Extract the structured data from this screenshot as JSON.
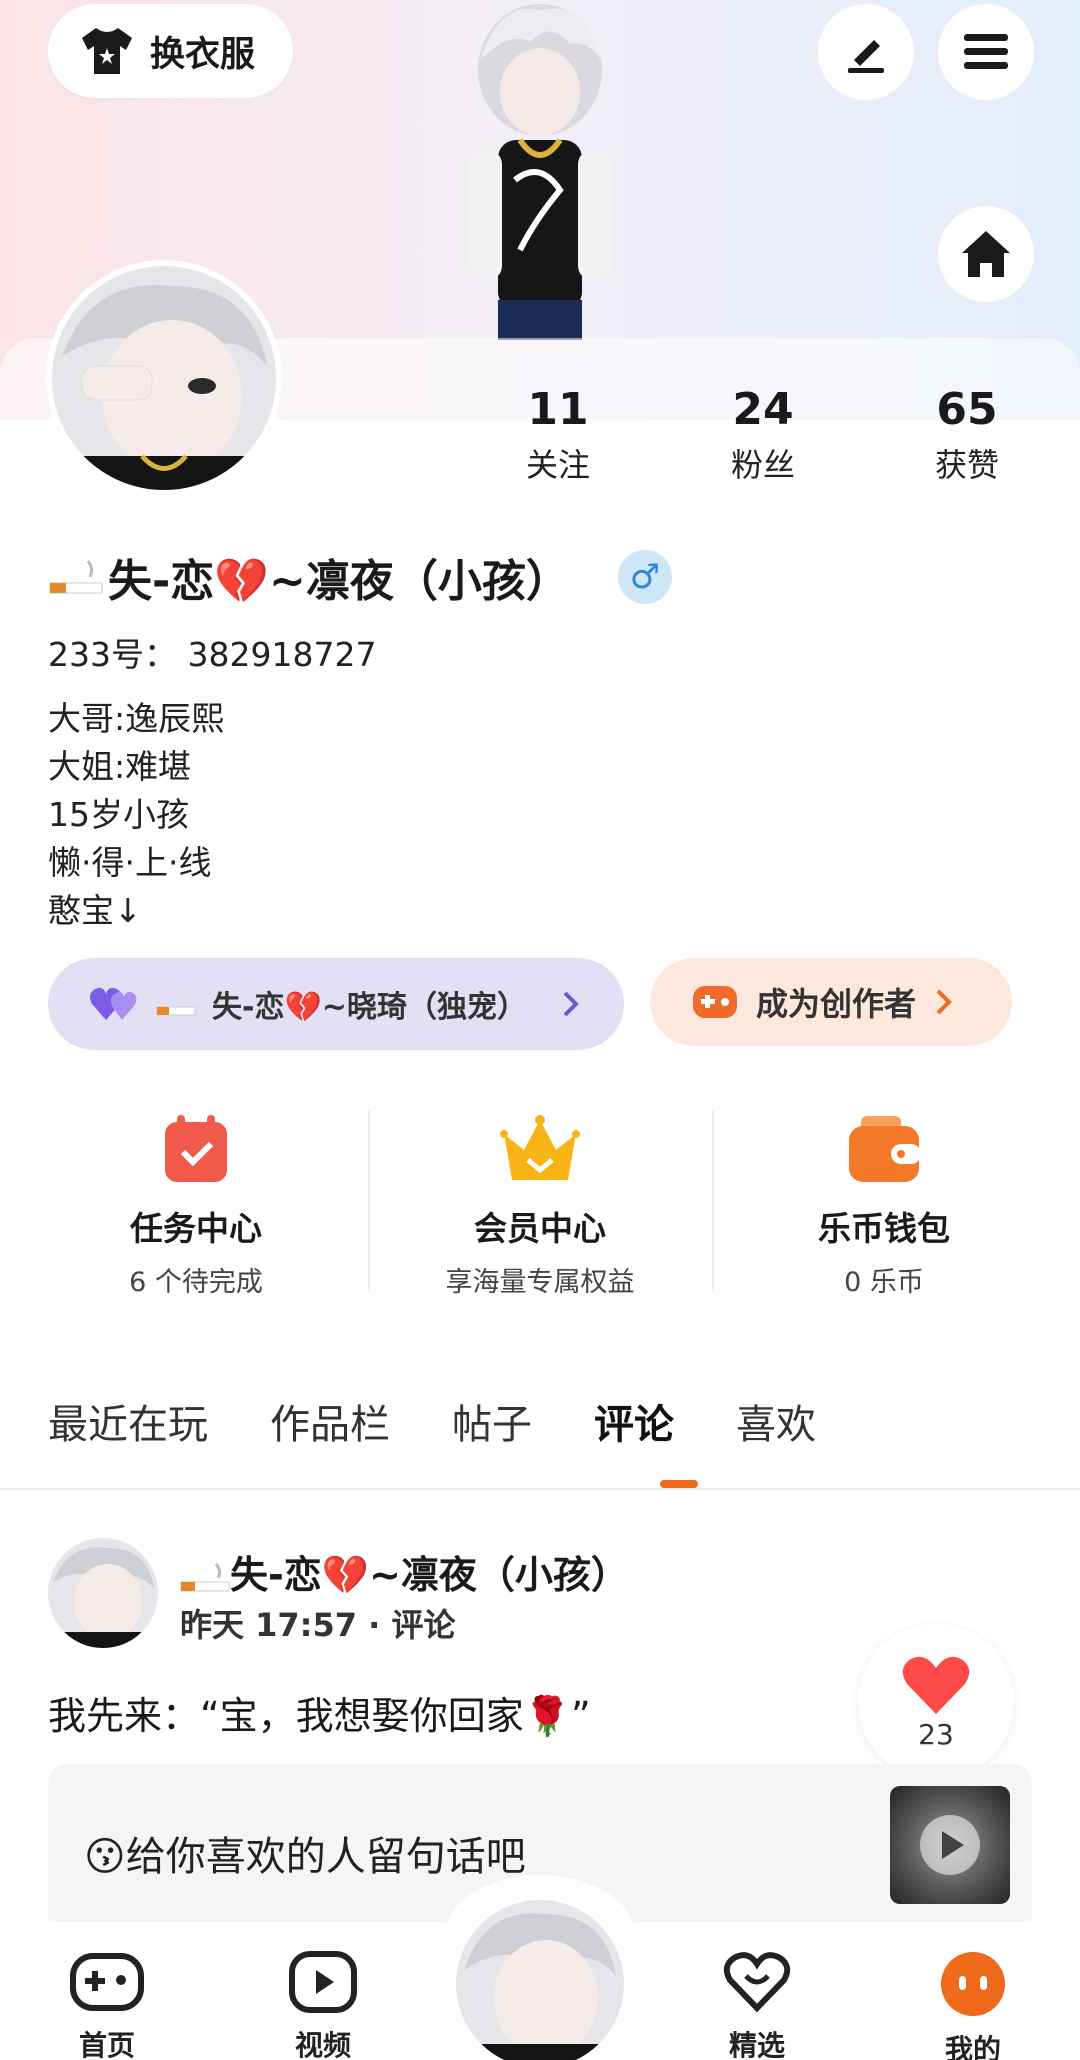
{
  "header": {
    "dress_button_label": "换衣服"
  },
  "stats": [
    {
      "count": "11",
      "label": "关注"
    },
    {
      "count": "24",
      "label": "粉丝"
    },
    {
      "count": "65",
      "label": "获赞"
    }
  ],
  "profile": {
    "name": "失-恋💔~凛夜（小孩）",
    "gender_symbol": "♂",
    "uid": "233号：  382918727",
    "bio_lines": [
      "大哥:逸辰熙",
      "大姐:难堪",
      "15岁小孩",
      "懒·得·上·线",
      "憨宝↓"
    ]
  },
  "love_link": {
    "label": "失-恋💔~晓琦（独宠）"
  },
  "creator": {
    "label": "成为创作者"
  },
  "services": [
    {
      "title": "任务中心",
      "sub": "6 个待完成",
      "icon": "calendar-check-icon",
      "color": "#f15a4a"
    },
    {
      "title": "会员中心",
      "sub": "享海量专属权益",
      "icon": "crown-icon",
      "color": "#f9b516"
    },
    {
      "title": "乐币钱包",
      "sub": "0 乐币",
      "icon": "wallet-icon",
      "color": "#f47a2a"
    }
  ],
  "tabs": [
    "最近在玩",
    "作品栏",
    "帖子",
    "评论",
    "喜欢"
  ],
  "active_tab": "评论",
  "post": {
    "author": "失-恋💔~凛夜（小孩）",
    "meta": "昨天 17:57 · 评论",
    "text": "我先来：“宝，我想娶你回家🌹”",
    "like_count": "23",
    "quote": "😗给你喜欢的人留句话吧"
  },
  "bottom_nav": [
    {
      "label": "首页",
      "icon": "gamepad-icon"
    },
    {
      "label": "视频",
      "icon": "play-icon"
    },
    {
      "label": "精选",
      "icon": "heart-icon"
    },
    {
      "label": "我的",
      "icon": "face-icon"
    }
  ],
  "colors": {
    "accent": "#f06a1c",
    "gender": "#2f8ad6",
    "like": "#ff4a4a"
  }
}
